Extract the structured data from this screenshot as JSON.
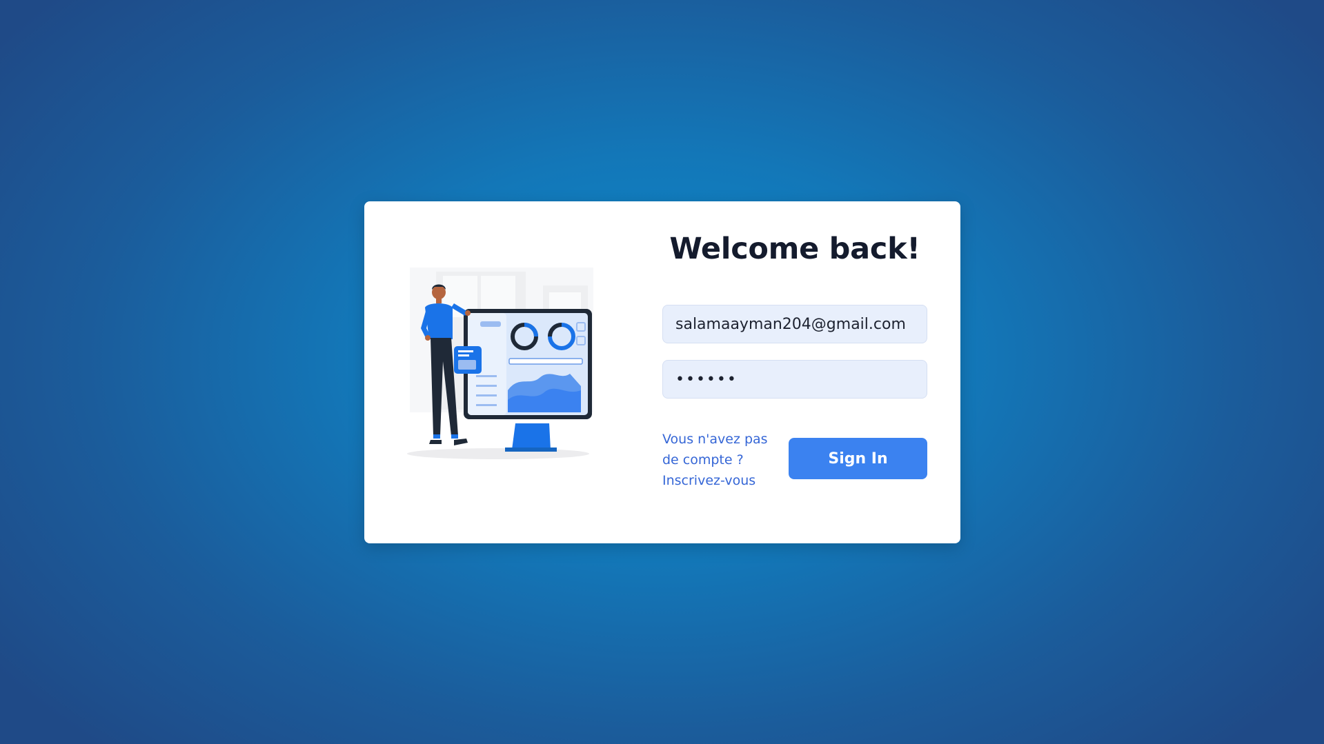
{
  "login": {
    "title": "Welcome back!",
    "email_value": "salamaayman204@gmail.com",
    "password_value": "••••••",
    "signup_link": "Vous n'avez pas de compte ? Inscrivez-vous",
    "signin_label": "Sign In"
  },
  "colors": {
    "accent": "#3b82f0",
    "link": "#3566d6",
    "input_bg": "#e8effc",
    "title": "#141b2d"
  },
  "icons": {
    "illustration": "person-presenting-dashboard-illustration"
  }
}
